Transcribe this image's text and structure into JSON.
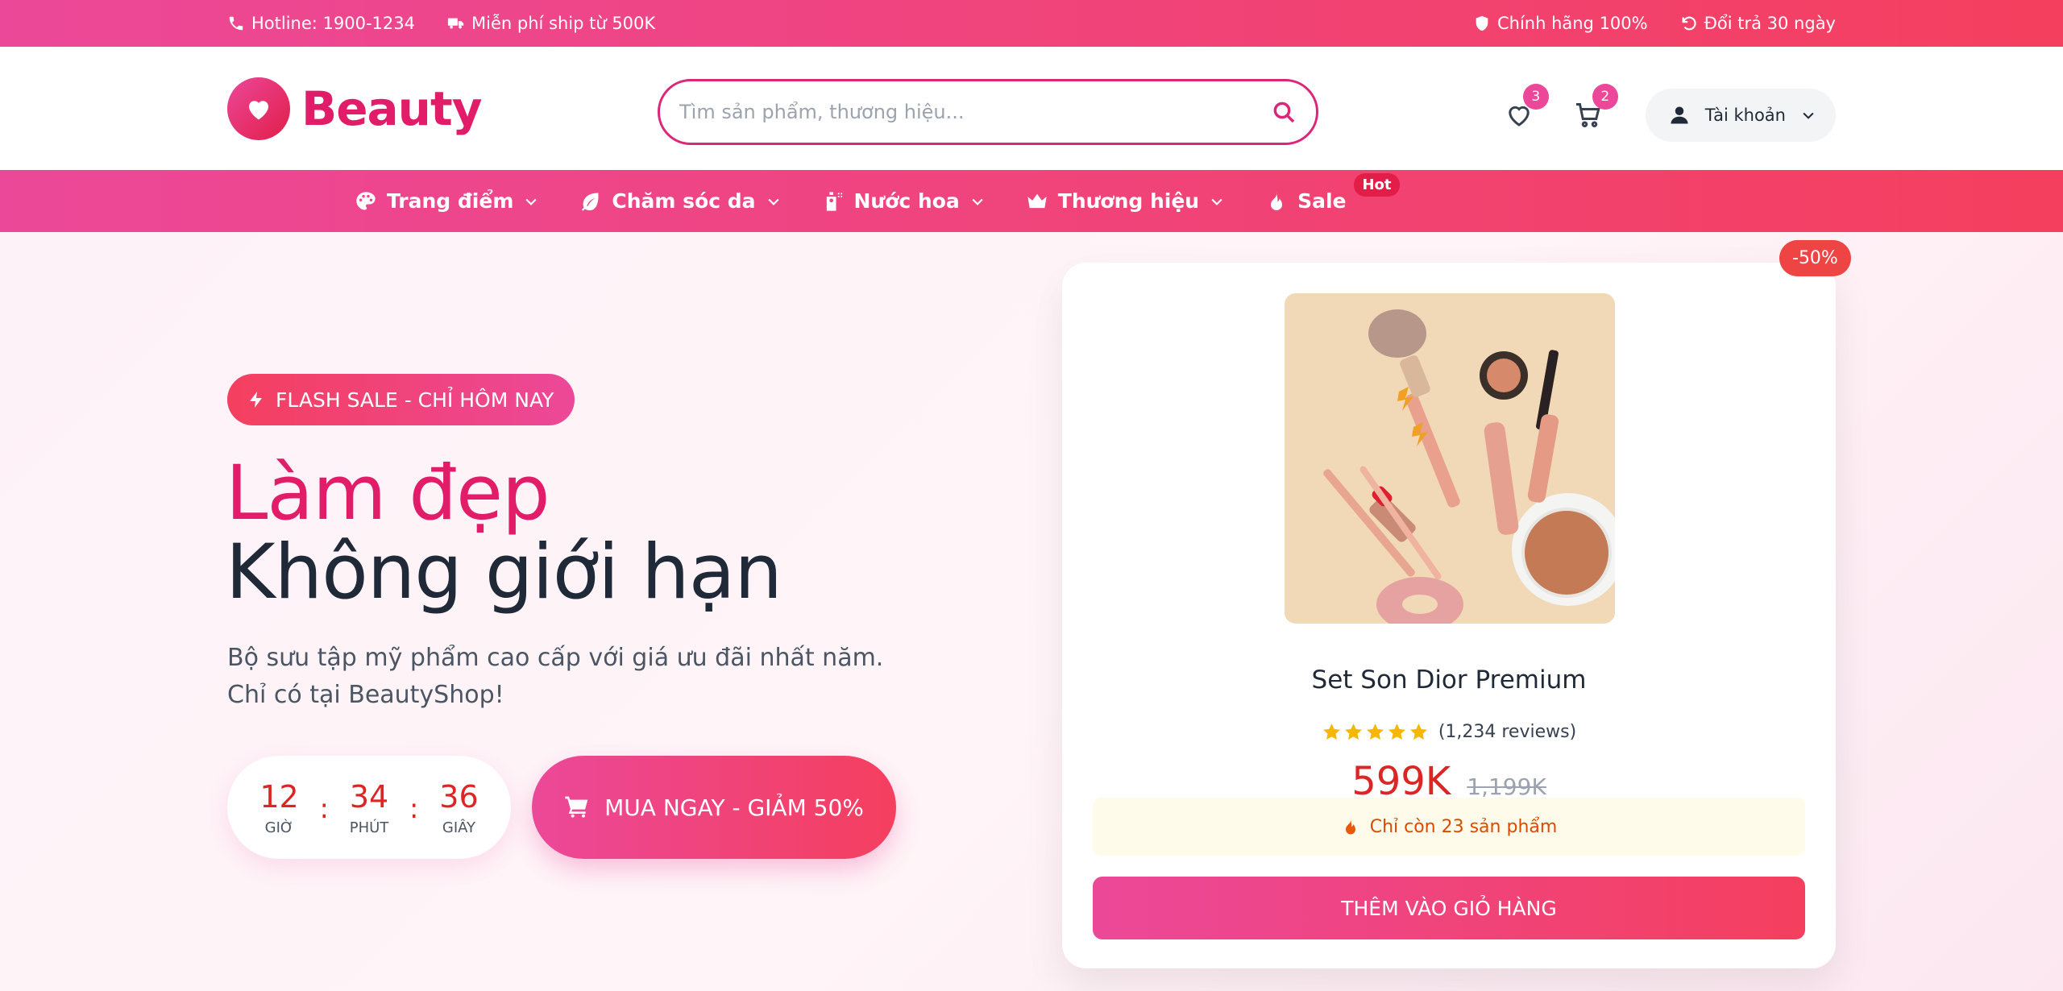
{
  "topbar": {
    "hotline": "Hotline: 1900-1234",
    "shipping": "Miễn phí ship từ 500K",
    "authentic": "Chính hãng 100%",
    "returns": "Đổi trả 30 ngày"
  },
  "header": {
    "logo_text": "Beauty",
    "search_placeholder": "Tìm sản phẩm, thương hiệu...",
    "wishlist_count": "3",
    "cart_count": "2",
    "account_label": "Tài khoản"
  },
  "nav": {
    "items": [
      {
        "label": "Trang điểm"
      },
      {
        "label": "Chăm sóc da"
      },
      {
        "label": "Nước hoa"
      },
      {
        "label": "Thương hiệu"
      },
      {
        "label": "Sale"
      }
    ],
    "hot_badge": "Hot"
  },
  "hero": {
    "flash_badge": "FLASH SALE - CHỈ HÔM NAY",
    "title_line1": "Làm đẹp",
    "title_line2": "Không giới hạn",
    "subtitle_line1": "Bộ sưu tập mỹ phẩm cao cấp với giá ưu đãi nhất năm.",
    "subtitle_line2": "Chỉ có tại BeautyShop!",
    "countdown": {
      "hours": "12",
      "hours_label": "GIỜ",
      "minutes": "34",
      "minutes_label": "PHÚT",
      "seconds": "36",
      "seconds_label": "GIÂY",
      "separator": ":"
    },
    "buy_button": "MUA NGAY - GIẢM 50%"
  },
  "product": {
    "discount_badge": "-50%",
    "name": "Set Son Dior Premium",
    "rating": 5,
    "reviews": "(1,234 reviews)",
    "price_now": "599K",
    "price_old": "1,199K",
    "stock_text": "Chỉ còn 23 sản phẩm",
    "add_to_cart": "THÊM VÀO GIỎ HÀNG"
  },
  "colors": {
    "brand_pink": "#ec4899",
    "brand_red": "#f43f5e",
    "price_red": "#dc2626",
    "star_yellow": "#f5b700"
  },
  "icons": {
    "topbar": [
      "phone-icon",
      "truck-icon",
      "shield-icon",
      "undo-icon"
    ],
    "header": [
      "heart-icon",
      "search-icon",
      "wishlist-heart-icon",
      "cart-icon",
      "user-icon",
      "chevron-down-icon"
    ],
    "nav": [
      "palette-icon",
      "leaf-icon",
      "perfume-icon",
      "crown-icon",
      "fire-icon"
    ],
    "hero": [
      "bolt-icon",
      "cart-icon"
    ],
    "product": [
      "star-icon",
      "fire-icon"
    ]
  }
}
